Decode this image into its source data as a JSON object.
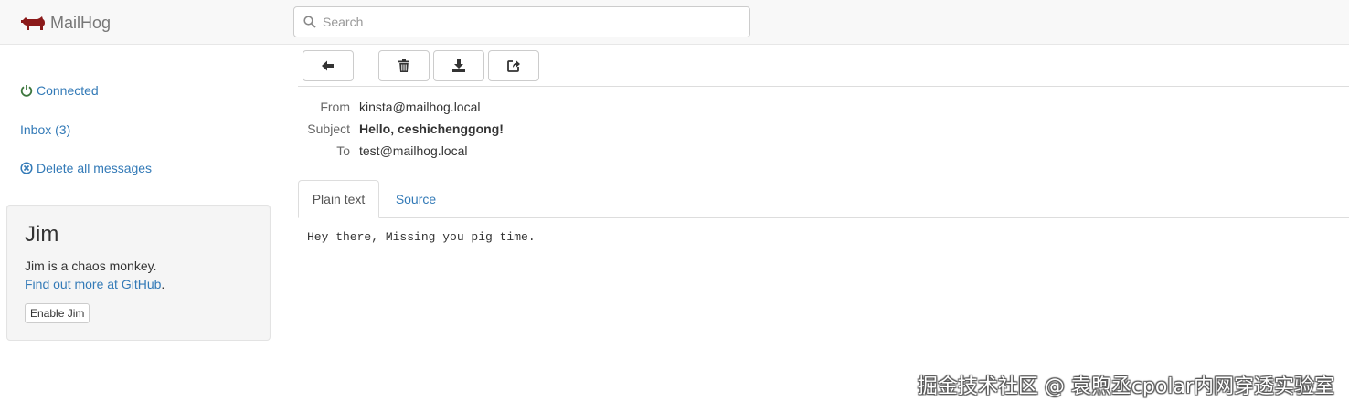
{
  "app": {
    "title": "MailHog"
  },
  "search": {
    "placeholder": "Search",
    "value": ""
  },
  "sidebar": {
    "connected": "Connected",
    "inbox": "Inbox (3)",
    "delete_all": "Delete all messages"
  },
  "jim": {
    "title": "Jim",
    "description": "Jim is a chaos monkey.",
    "more_link": "Find out more at GitHub",
    "more_suffix": ".",
    "enable_button": "Enable Jim"
  },
  "toolbar": {
    "buttons": [
      "back-arrow-icon",
      "trash-icon",
      "download-icon",
      "release-icon"
    ]
  },
  "message": {
    "from_label": "From",
    "from": "kinsta@mailhog.local",
    "subject_label": "Subject",
    "subject": "Hello, ceshichenggong!",
    "to_label": "To",
    "to": "test@mailhog.local",
    "body": "Hey there, Missing you pig time."
  },
  "tabs": [
    {
      "label": "Plain text",
      "active": true
    },
    {
      "label": "Source",
      "active": false
    }
  ],
  "watermark": "掘金技术社区 @ 袁煦丞cpolar内网穿透实验室",
  "colors": {
    "link": "#337ab7",
    "connected": "#3c763d",
    "brand": "#8b1a1a"
  }
}
